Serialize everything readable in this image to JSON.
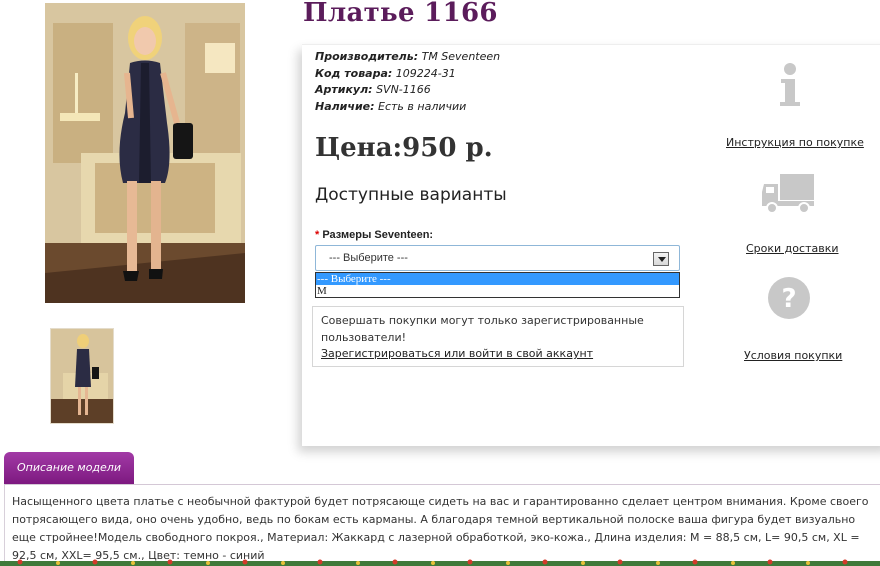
{
  "product": {
    "title": "Платье 1166",
    "specs": [
      {
        "label": "Производитель:",
        "value": "TM Seventeen"
      },
      {
        "label": "Код товара:",
        "value": "109224-31"
      },
      {
        "label": "Артикул:",
        "value": "SVN-1166"
      },
      {
        "label": "Наличие:",
        "value": "Есть в наличии"
      }
    ],
    "price": "Цена:950 р."
  },
  "variants": {
    "title": "Доступные варианты",
    "required_mark": "*",
    "size_label": "Размеры Seventeen:",
    "selected": "--- Выберите ---",
    "options": [
      "--- Выберите ---",
      "M"
    ]
  },
  "notice": {
    "text": "Совершать покупки могут только зарегистрированные пользователи!",
    "link": "Зарегистрироваться или войти в свой аккаунт"
  },
  "side_links": {
    "instruction": "Инструкция по покупке",
    "delivery": "Сроки доставки",
    "terms": "Условия покупки"
  },
  "description": {
    "tab": "Описание модели",
    "text": "Насыщенного цвета платье с необычной фактурой будет потрясающе сидеть на вас и гарантированно сделает центром внимания. Кроме своего потрясающего вида, оно очень удобно, ведь по бокам есть карманы. А благодаря темной вертикальной полоске ваша фигура будет визуально еще стройнее!Модель свободного покроя., Материал: Жаккард с лазерной обработкой, эко-кожа., Длина изделия: М = 88,5 см, L= 90,5 см, XL = 92,5 см, XXL= 95,5 см., Цвет: темно - синий"
  },
  "colors": {
    "title": "#5b1c5b",
    "tab": "#8e2a92",
    "select_border": "#8fb7d8",
    "option_highlight": "#3399ff",
    "required": "#dd0000"
  }
}
